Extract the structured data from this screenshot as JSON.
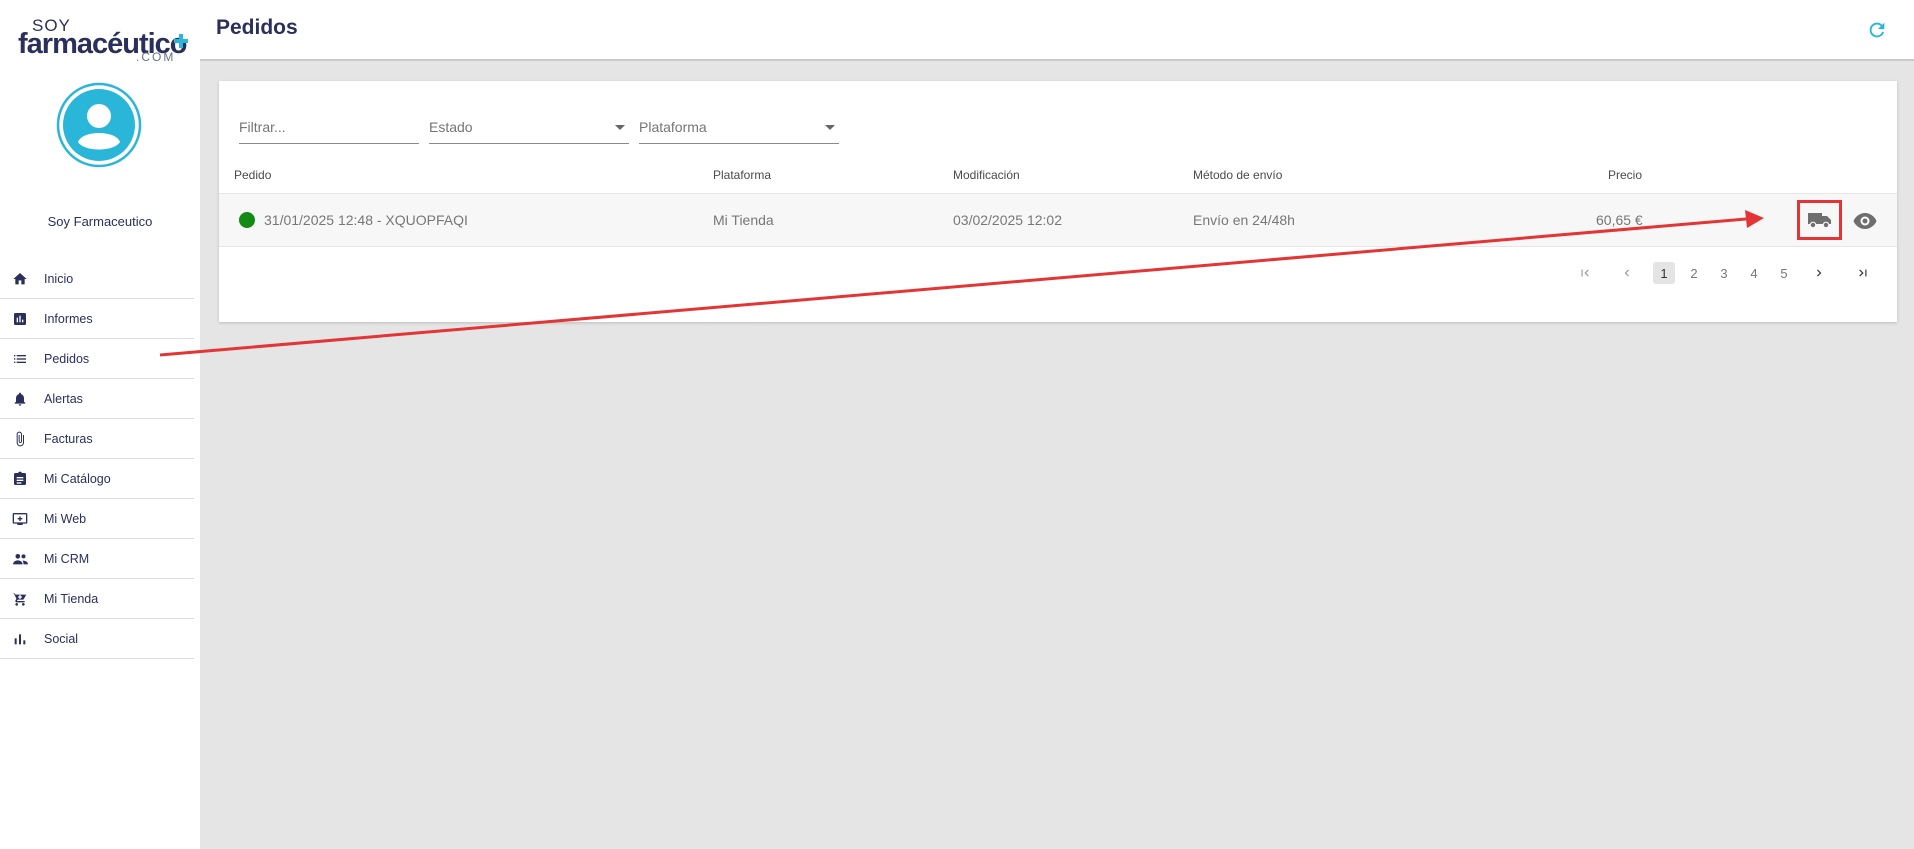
{
  "logo": {
    "line1": "SOY",
    "line2": "farmacéutico",
    "line3": ".COM"
  },
  "sidebar": {
    "username": "Soy Farmaceutico",
    "items": [
      {
        "label": "Inicio",
        "icon": "home-icon"
      },
      {
        "label": "Informes",
        "icon": "report-icon"
      },
      {
        "label": "Pedidos",
        "icon": "list-icon"
      },
      {
        "label": "Alertas",
        "icon": "bell-icon"
      },
      {
        "label": "Facturas",
        "icon": "paperclip-icon"
      },
      {
        "label": "Mi Catálogo",
        "icon": "clipboard-icon"
      },
      {
        "label": "Mi Web",
        "icon": "monitor-icon"
      },
      {
        "label": "Mi CRM",
        "icon": "people-icon"
      },
      {
        "label": "Mi Tienda",
        "icon": "cart-icon"
      },
      {
        "label": "Social",
        "icon": "bar-chart-icon"
      }
    ]
  },
  "header": {
    "title": "Pedidos"
  },
  "filters": {
    "search_placeholder": "Filtrar...",
    "estado_label": "Estado",
    "plataforma_label": "Plataforma"
  },
  "table": {
    "columns": [
      "Pedido",
      "Plataforma",
      "Modificación",
      "Método de envío",
      "Precio"
    ],
    "rows": [
      {
        "pedido": "31/01/2025 12:48 - XQUOPFAQI",
        "plataforma": "Mi Tienda",
        "modificacion": "03/02/2025 12:02",
        "metodo_envio": "Envío en 24/48h",
        "precio": "60,65 €",
        "status_color": "#138a13"
      }
    ]
  },
  "pagination": {
    "pages": [
      "1",
      "2",
      "3",
      "4",
      "5"
    ],
    "current": "1"
  },
  "colors": {
    "accent": "#29b6d9",
    "navy": "#2b2f5c",
    "annotation": "#e33535"
  }
}
